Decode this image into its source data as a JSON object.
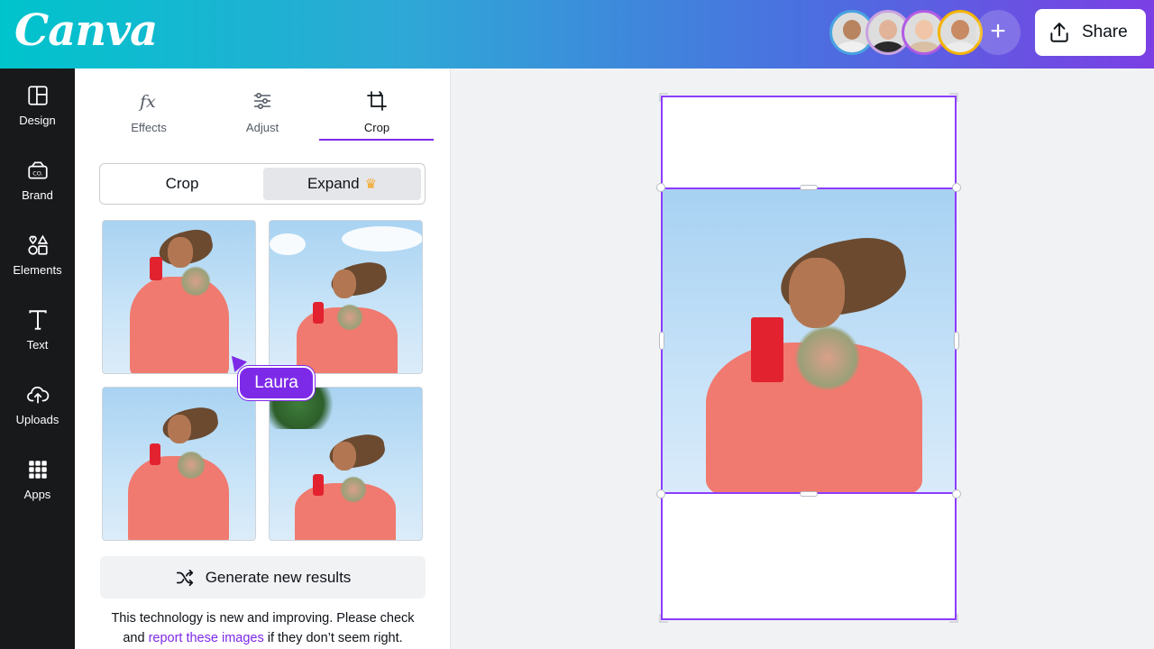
{
  "header": {
    "logo_text": "Canva",
    "share_label": "Share",
    "add_collaborator_symbol": "+",
    "collaborators": [
      {
        "ring": "#4aa3df",
        "skin": "#b88460",
        "shirt": "#f0f0f0"
      },
      {
        "ring": "#c9a3e0",
        "skin": "#e1b49a",
        "shirt": "#2a2a2a"
      },
      {
        "ring": "#b15ce3",
        "skin": "#f1c6a8",
        "shirt": "#d9c0a5"
      },
      {
        "ring": "#f5b400",
        "skin": "#c88a62",
        "shirt": "#ececec"
      }
    ]
  },
  "rail": {
    "items": [
      {
        "label": "Design",
        "icon": "layout-icon"
      },
      {
        "label": "Brand",
        "icon": "brand-icon"
      },
      {
        "label": "Elements",
        "icon": "elements-icon"
      },
      {
        "label": "Text",
        "icon": "text-icon"
      },
      {
        "label": "Uploads",
        "icon": "upload-icon"
      },
      {
        "label": "Apps",
        "icon": "apps-icon"
      }
    ]
  },
  "panel": {
    "tabs": [
      {
        "label": "Effects",
        "icon": "fx-icon",
        "active": false
      },
      {
        "label": "Adjust",
        "icon": "sliders-icon",
        "active": false
      },
      {
        "label": "Crop",
        "icon": "crop-icon",
        "active": true
      }
    ],
    "segment": {
      "crop_label": "Crop",
      "expand_label": "Expand",
      "expand_selected": true
    },
    "collaborator_cursor_name": "Laura",
    "generate_label": "Generate new results",
    "disclaimer_before": "This technology is new and improving. Please check and ",
    "disclaimer_link": "report these images",
    "disclaimer_after": " if they don’t seem right."
  },
  "colors": {
    "accent": "#7d2ae8",
    "selection": "#8b3dff",
    "rail_bg": "#18191b"
  }
}
